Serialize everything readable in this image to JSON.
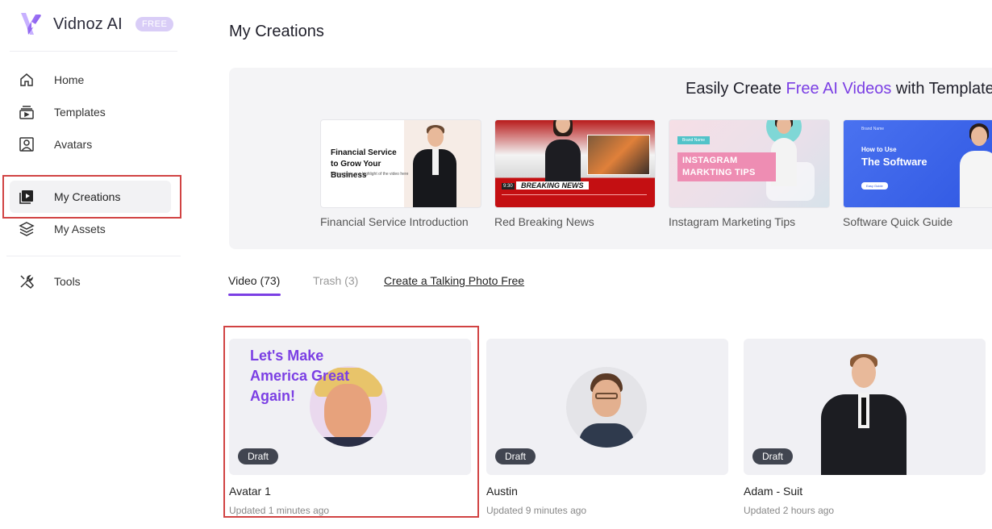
{
  "brand": {
    "name": "Vidnoz AI",
    "badge": "FREE",
    "accent": "#7b3fe4"
  },
  "sidebar": {
    "items": [
      {
        "label": "Home",
        "icon": "home-icon"
      },
      {
        "label": "Templates",
        "icon": "templates-icon"
      },
      {
        "label": "Avatars",
        "icon": "avatar-icon"
      },
      {
        "label": "My Creations",
        "icon": "play-square-icon",
        "active": true
      },
      {
        "label": "My Assets",
        "icon": "layers-icon"
      },
      {
        "label": "Tools",
        "icon": "tools-icon"
      }
    ]
  },
  "page": {
    "title": "My Creations"
  },
  "banner": {
    "heading_pre": "Easily Create ",
    "heading_accent": "Free AI Videos",
    "heading_post": " with Template",
    "templates": [
      {
        "label": "Financial Service Introduction",
        "thumb_heading": "Financial Service to Grow Your Business",
        "thumb_sub": "Write a topic or a highlight of the video here"
      },
      {
        "label": "Red Breaking News",
        "thumb_heading": "BREAKING NEWS",
        "thumb_time": "9:30"
      },
      {
        "label": "Instagram Marketing Tips",
        "thumb_brand": "Brand Name",
        "thumb_heading": "INSTAGRAM MARKTING TIPS"
      },
      {
        "label": "Software Quick Guide",
        "thumb_brand": "Brand Name",
        "thumb_line1": "How to Use",
        "thumb_line2": "The Software",
        "thumb_button": "Easy Guide"
      }
    ]
  },
  "tabs": {
    "video": "Video (73)",
    "trash": "Trash (3)",
    "link": "Create a Talking Photo Free"
  },
  "cards": [
    {
      "title": "Avatar 1",
      "updated": "Updated 1 minutes ago",
      "badge": "Draft",
      "slogan": "Let's Make America Great Again!"
    },
    {
      "title": "Austin",
      "updated": "Updated 9 minutes ago",
      "badge": "Draft"
    },
    {
      "title": "Adam - Suit",
      "updated": "Updated 2 hours ago",
      "badge": "Draft"
    }
  ]
}
